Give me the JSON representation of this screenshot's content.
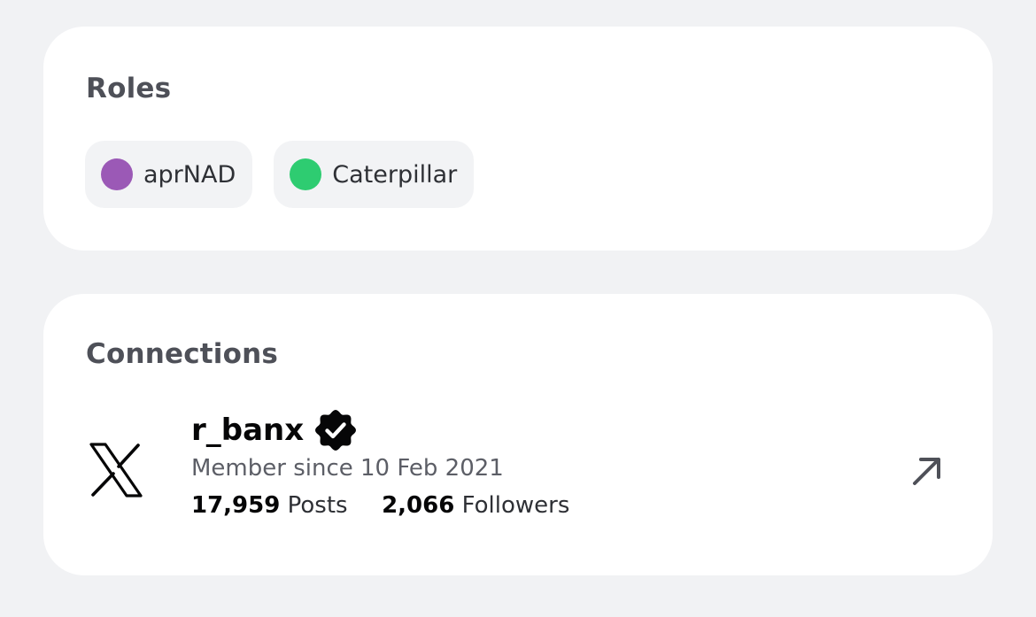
{
  "roles": {
    "title": "Roles",
    "items": [
      {
        "label": "aprNAD",
        "color": "#9b59b6"
      },
      {
        "label": "Caterpillar",
        "color": "#2ecc71"
      }
    ]
  },
  "connections": {
    "title": "Connections",
    "items": [
      {
        "platform_icon": "x-logo-icon",
        "name": "r_banx",
        "verified": true,
        "member_since": "Member since 10 Feb 2021",
        "posts_count": "17,959",
        "posts_label": "Posts",
        "followers_count": "2,066",
        "followers_label": "Followers",
        "action_icon": "arrow-up-right-icon"
      }
    ]
  }
}
